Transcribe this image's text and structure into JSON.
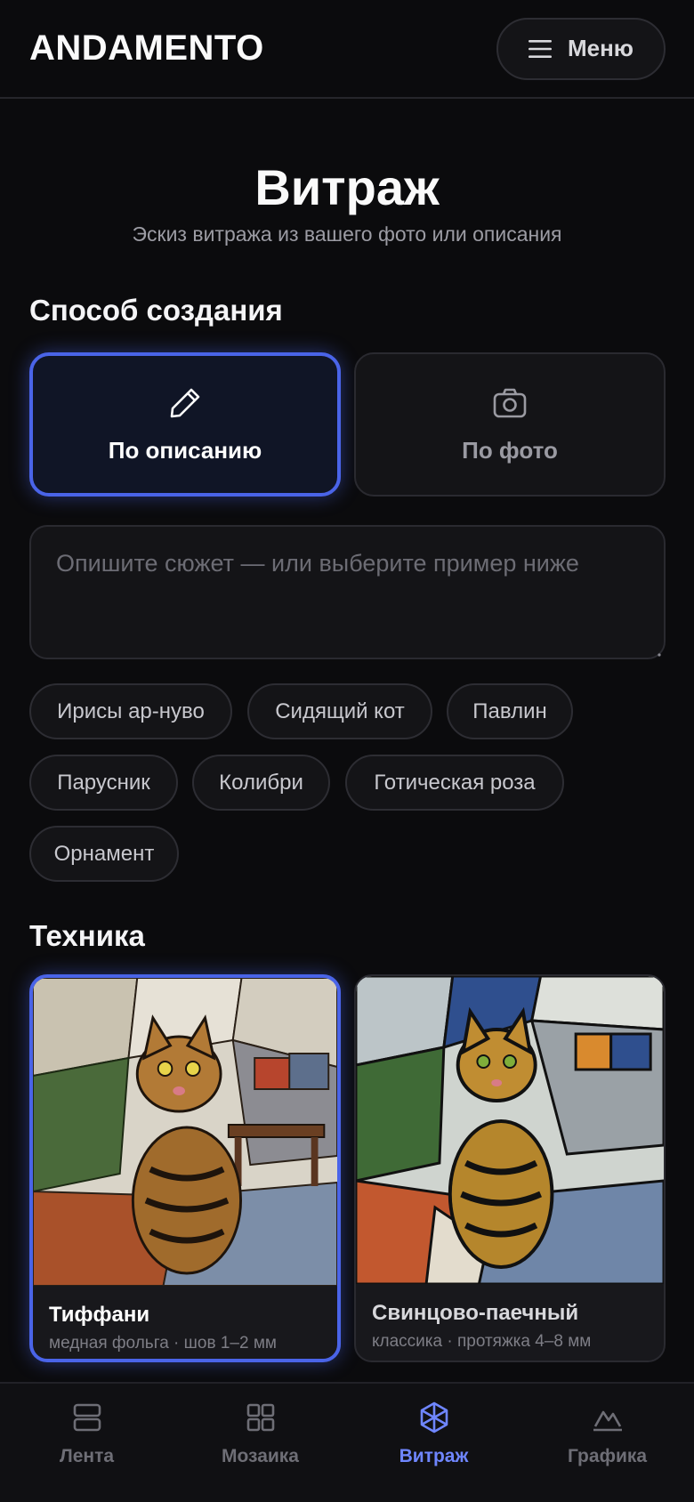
{
  "header": {
    "logo": "ANDAMENTO",
    "menu_label": "Меню",
    "menu_icon": "hamburger-icon"
  },
  "page": {
    "title": "Витраж",
    "subtitle": "Эскиз витража из вашего фото или описания"
  },
  "creation": {
    "heading": "Способ создания",
    "modes": [
      {
        "label": "По описанию",
        "icon": "pencil-icon",
        "selected": true
      },
      {
        "label": "По фото",
        "icon": "camera-icon",
        "selected": false
      }
    ]
  },
  "description": {
    "placeholder": "Опишите сюжет — или выберите пример ниже",
    "value": ""
  },
  "examples": [
    "Ирисы ар-нуво",
    "Сидящий кот",
    "Павлин",
    "Парусник",
    "Колибри",
    "Готическая роза",
    "Орнамент"
  ],
  "technique": {
    "heading": "Техника",
    "options": [
      {
        "name": "Тиффани",
        "detail": "медная фольга · шов 1–2 мм",
        "selected": true
      },
      {
        "name": "Свинцово-паечный",
        "detail": "классика · протяжка 4–8 мм",
        "selected": false
      }
    ]
  },
  "nav": [
    {
      "label": "Лента",
      "icon": "feed-icon",
      "active": false
    },
    {
      "label": "Мозаика",
      "icon": "grid-icon",
      "active": false
    },
    {
      "label": "Витраж",
      "icon": "stained-glass-icon",
      "active": true
    },
    {
      "label": "Графика",
      "icon": "mountains-icon",
      "active": false
    }
  ],
  "colors": {
    "accent": "#4a64e8",
    "nav_active": "#6f86ff",
    "background": "#0b0b0d"
  }
}
